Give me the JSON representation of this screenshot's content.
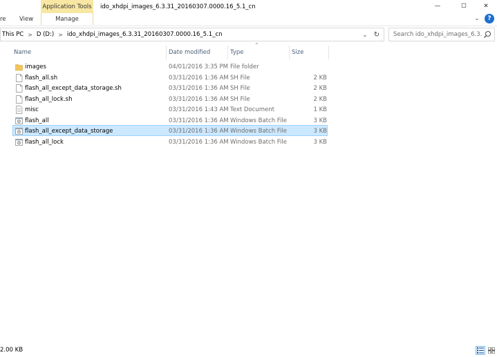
{
  "window": {
    "title": "ido_xhdpi_images_6.3.31_20160307.0000.16_5.1_cn",
    "minimize": "—",
    "maximize": "☐",
    "close": "✕"
  },
  "ribbon": {
    "tabs": [
      "re",
      "View"
    ],
    "context_group": "Application Tools",
    "context_tab": "Manage",
    "collapse_icon": "chevron-down-icon",
    "help": "?"
  },
  "address": {
    "crumbs": [
      "This PC",
      "D (D:)",
      "ido_xhdpi_images_6.3.31_20160307.0000.16_5.1_cn"
    ],
    "separator": ">"
  },
  "search": {
    "placeholder": "Search ido_xhdpi_images_6.3...."
  },
  "columns": {
    "name": "Name",
    "date": "Date modified",
    "type": "Type",
    "size": "Size"
  },
  "files": [
    {
      "name": "images",
      "date": "04/01/2016 3:35 PM",
      "type": "File folder",
      "size": "",
      "icon": "folder-icon"
    },
    {
      "name": "flash_all.sh",
      "date": "03/31/2016 1:36 AM",
      "type": "SH File",
      "size": "2 KB",
      "icon": "file-icon"
    },
    {
      "name": "flash_all_except_data_storage.sh",
      "date": "03/31/2016 1:36 AM",
      "type": "SH File",
      "size": "2 KB",
      "icon": "file-icon"
    },
    {
      "name": "flash_all_lock.sh",
      "date": "03/31/2016 1:36 AM",
      "type": "SH File",
      "size": "2 KB",
      "icon": "file-icon"
    },
    {
      "name": "misc",
      "date": "03/31/2016 1:43 AM",
      "type": "Text Document",
      "size": "1 KB",
      "icon": "text-document-icon"
    },
    {
      "name": "flash_all",
      "date": "03/31/2016 1:36 AM",
      "type": "Windows Batch File",
      "size": "3 KB",
      "icon": "batch-file-icon"
    },
    {
      "name": "flash_all_except_data_storage",
      "date": "03/31/2016 1:36 AM",
      "type": "Windows Batch File",
      "size": "3 KB",
      "icon": "batch-file-icon",
      "selected": true
    },
    {
      "name": "flash_all_lock",
      "date": "03/31/2016 1:36 AM",
      "type": "Windows Batch File",
      "size": "3 KB",
      "icon": "batch-file-icon"
    }
  ],
  "status": {
    "text": "2.00 KB"
  },
  "colors": {
    "selection_bg": "#cce8ff",
    "selection_border": "#99d1ff",
    "context_tab": "#f8e7a2",
    "header_text": "#4c607a"
  }
}
